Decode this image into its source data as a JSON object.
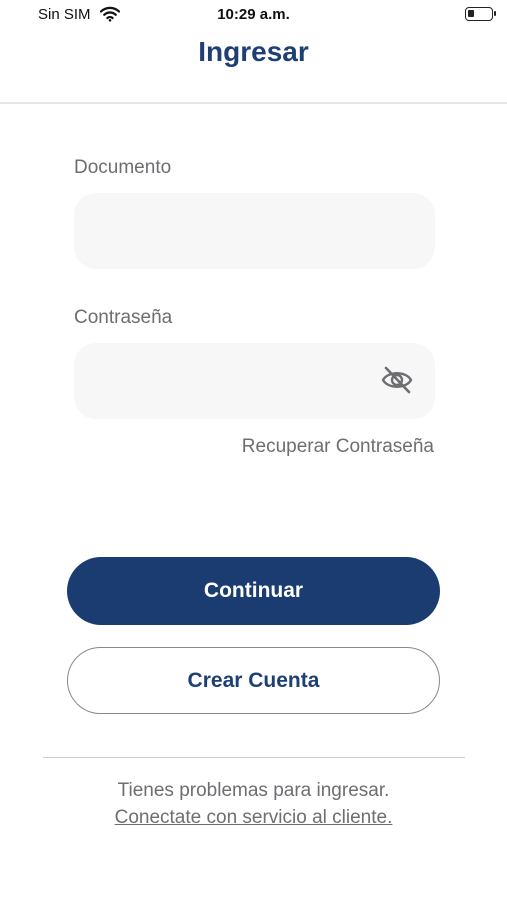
{
  "status_bar": {
    "carrier": "Sin SIM",
    "time": "10:29 a.m."
  },
  "header": {
    "title": "Ingresar"
  },
  "form": {
    "document_label": "Documento",
    "document_value": "",
    "password_label": "Contraseña",
    "password_value": "",
    "recover_password": "Recuperar Contraseña"
  },
  "actions": {
    "continue_label": "Continuar",
    "create_account_label": "Crear Cuenta"
  },
  "help": {
    "text": "Tienes problemas para ingresar.",
    "link": "Conectate con servicio al cliente."
  },
  "icons": {
    "wifi": "wifi-icon",
    "battery": "battery-icon",
    "password_toggle": "eye-off-icon"
  },
  "colors": {
    "primary": "#1b3c70",
    "title": "#1e3f74",
    "muted_text": "#6e6e72",
    "input_bg": "#f7f7f8"
  }
}
